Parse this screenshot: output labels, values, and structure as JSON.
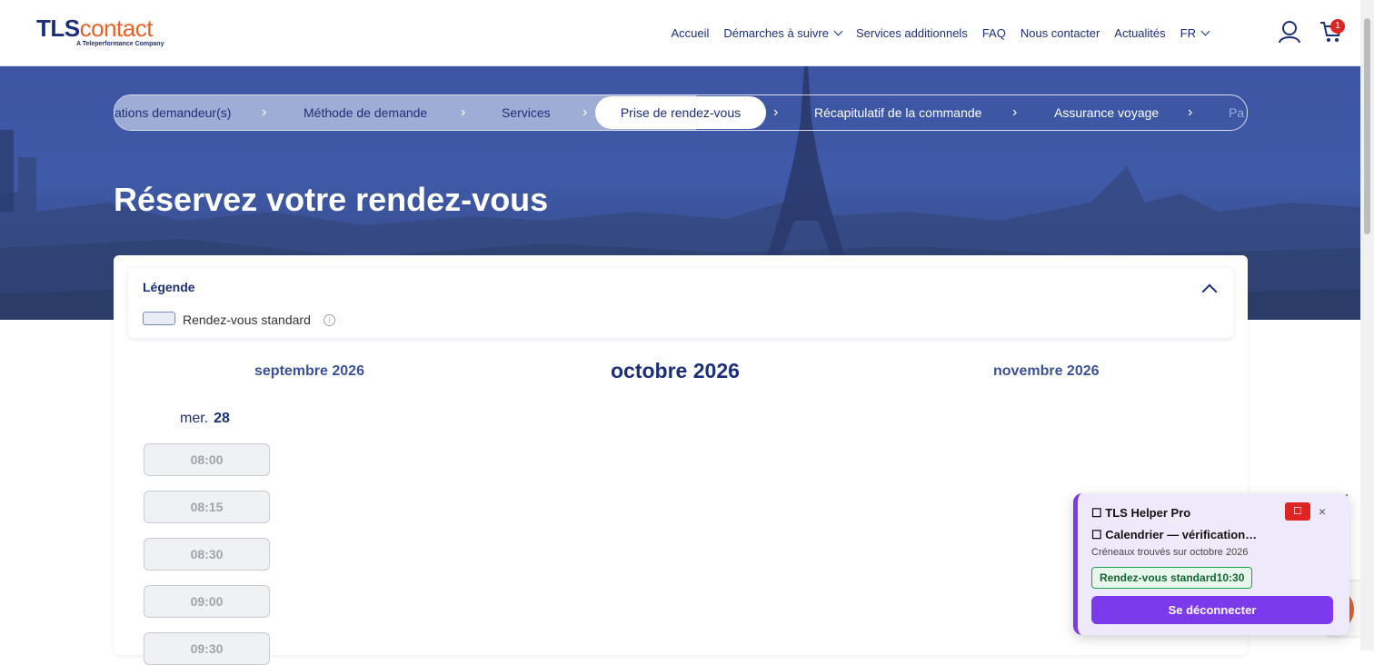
{
  "logo": {
    "brand_part1": "TLS",
    "brand_part2": "contact",
    "tagline": "A Teleperformance Company"
  },
  "nav": {
    "items": [
      "Accueil",
      "Démarches à suivre",
      "Services additionnels",
      "FAQ",
      "Nous contacter",
      "Actualités"
    ],
    "language": "FR",
    "cart_count": "1"
  },
  "steps": {
    "completed": [
      "ations demandeur(s)",
      "Méthode de demande",
      "Services"
    ],
    "active": "Prise de rendez-vous",
    "upcoming": [
      "Récapitulatif de la commande",
      "Assurance voyage",
      "Pa"
    ]
  },
  "hero": {
    "title": "Réservez votre rendez-vous"
  },
  "legend": {
    "title": "Légende",
    "items": [
      {
        "label": "Rendez-vous standard"
      }
    ]
  },
  "calendar": {
    "prev_month": "septembre 2026",
    "current_month": "octobre 2026",
    "next_month": "novembre 2026",
    "day": {
      "weekday": "mer.",
      "date": "28"
    },
    "slots": [
      "08:00",
      "08:15",
      "08:30",
      "09:00",
      "09:30"
    ]
  },
  "helper": {
    "title": "TLS Helper Pro",
    "status": "Calendrier — vérification…",
    "subtitle": "Créneaux trouvés sur octobre 2026",
    "chip": "Rendez-vous standard10:30",
    "button": "Se déconnecter",
    "close": "×"
  },
  "colors": {
    "brand_blue": "#1e2f7a",
    "brand_orange": "#e8612a",
    "helper_purple": "#7c3aed",
    "success_green": "#16a34a"
  }
}
